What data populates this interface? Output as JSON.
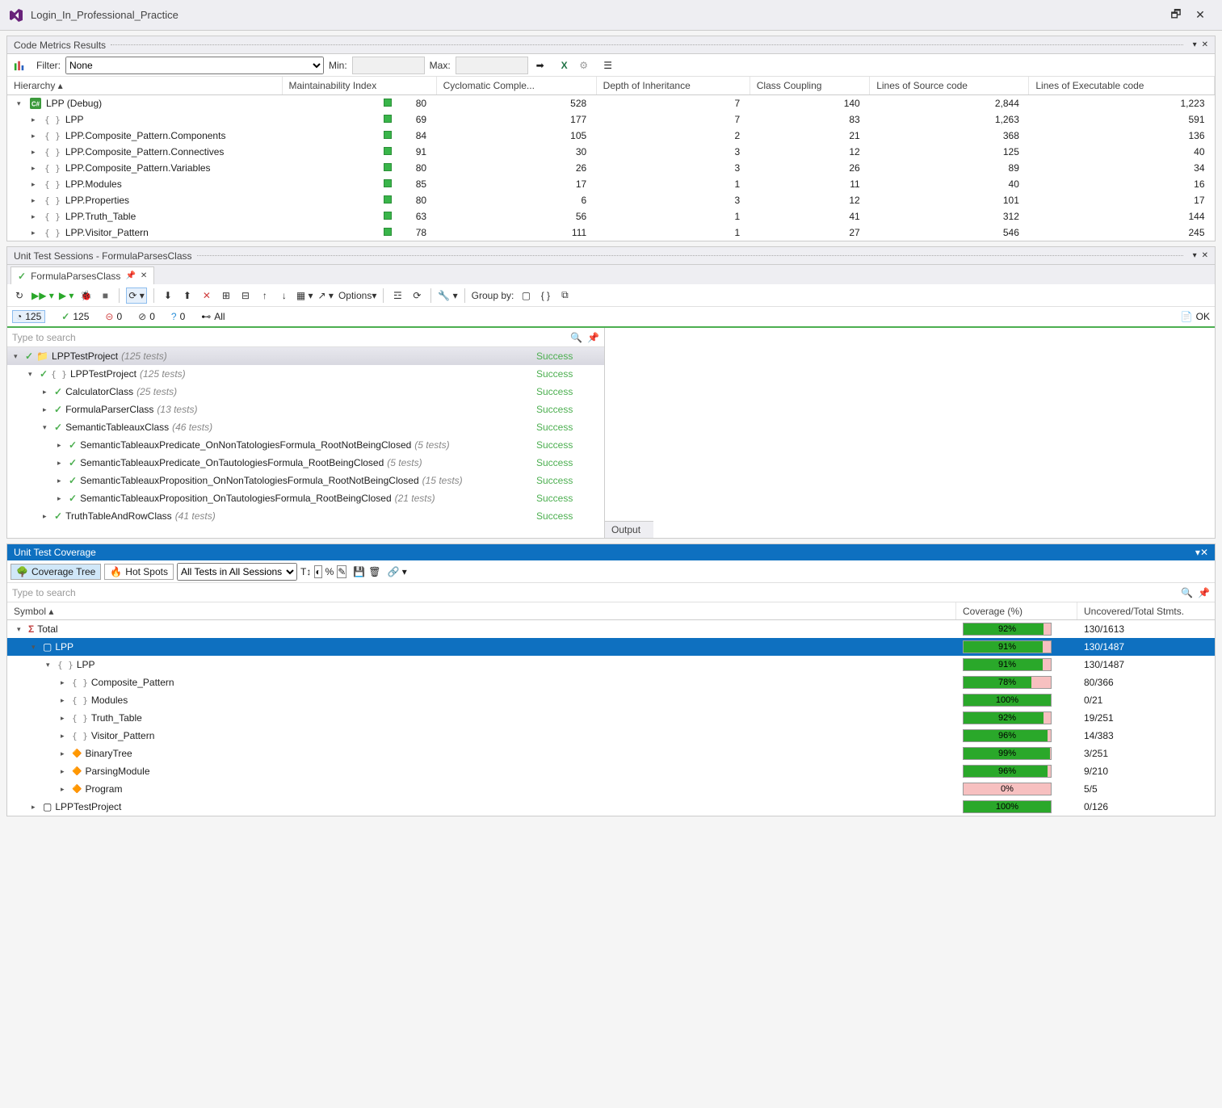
{
  "window": {
    "title": "Login_In_Professional_Practice"
  },
  "metrics": {
    "title": "Code Metrics Results",
    "filter_label": "Filter:",
    "filter_value": "None",
    "min_label": "Min:",
    "max_label": "Max:",
    "columns": [
      "Hierarchy",
      "Maintainability Index",
      "Cyclomatic Comple...",
      "Depth of Inheritance",
      "Class Coupling",
      "Lines of Source code",
      "Lines of Executable code"
    ],
    "rows": [
      {
        "indent": 0,
        "tri": "▾",
        "icon": "cs",
        "name": "LPP (Debug)",
        "vals": [
          "80",
          "528",
          "7",
          "140",
          "2,844",
          "1,223"
        ]
      },
      {
        "indent": 1,
        "tri": "▸",
        "icon": "ns",
        "name": "LPP",
        "vals": [
          "69",
          "177",
          "7",
          "83",
          "1,263",
          "591"
        ]
      },
      {
        "indent": 1,
        "tri": "▸",
        "icon": "ns",
        "name": "LPP.Composite_Pattern.Components",
        "vals": [
          "84",
          "105",
          "2",
          "21",
          "368",
          "136"
        ]
      },
      {
        "indent": 1,
        "tri": "▸",
        "icon": "ns",
        "name": "LPP.Composite_Pattern.Connectives",
        "vals": [
          "91",
          "30",
          "3",
          "12",
          "125",
          "40"
        ]
      },
      {
        "indent": 1,
        "tri": "▸",
        "icon": "ns",
        "name": "LPP.Composite_Pattern.Variables",
        "vals": [
          "80",
          "26",
          "3",
          "26",
          "89",
          "34"
        ]
      },
      {
        "indent": 1,
        "tri": "▸",
        "icon": "ns",
        "name": "LPP.Modules",
        "vals": [
          "85",
          "17",
          "1",
          "11",
          "40",
          "16"
        ]
      },
      {
        "indent": 1,
        "tri": "▸",
        "icon": "ns",
        "name": "LPP.Properties",
        "vals": [
          "80",
          "6",
          "3",
          "12",
          "101",
          "17"
        ]
      },
      {
        "indent": 1,
        "tri": "▸",
        "icon": "ns",
        "name": "LPP.Truth_Table",
        "vals": [
          "63",
          "56",
          "1",
          "41",
          "312",
          "144"
        ]
      },
      {
        "indent": 1,
        "tri": "▸",
        "icon": "ns",
        "name": "LPP.Visitor_Pattern",
        "vals": [
          "78",
          "111",
          "1",
          "27",
          "546",
          "245"
        ]
      }
    ]
  },
  "tests": {
    "title": "Unit Test Sessions - FormulaParsesClass",
    "tab": "FormulaParsesClass",
    "options_label": "Options",
    "groupby_label": "Group by:",
    "counts": {
      "total": "125",
      "passed": "125",
      "failed": "0",
      "ignored": "0",
      "unknown": "0",
      "all": "All"
    },
    "search_placeholder": "Type to search",
    "status_ok": "OK",
    "status_success": "Success",
    "output_label": "Output",
    "tree": [
      {
        "indent": 0,
        "tri": "▾",
        "icon": "proj",
        "name": "LPPTestProject",
        "count": "(125 tests)",
        "root": true
      },
      {
        "indent": 1,
        "tri": "▾",
        "icon": "ns",
        "name": "LPPTestProject",
        "count": "(125 tests)"
      },
      {
        "indent": 2,
        "tri": "▸",
        "icon": "chk",
        "name": "CalculatorClass",
        "count": "(25 tests)"
      },
      {
        "indent": 2,
        "tri": "▸",
        "icon": "chk",
        "name": "FormulaParserClass",
        "count": "(13 tests)"
      },
      {
        "indent": 2,
        "tri": "▾",
        "icon": "chk",
        "name": "SemanticTableauxClass",
        "count": "(46 tests)"
      },
      {
        "indent": 3,
        "tri": "▸",
        "icon": "chk",
        "name": "SemanticTableauxPredicate_OnNonTatologiesFormula_RootNotBeingClosed",
        "count": "(5 tests)"
      },
      {
        "indent": 3,
        "tri": "▸",
        "icon": "chk",
        "name": "SemanticTableauxPredicate_OnTautologiesFormula_RootBeingClosed",
        "count": "(5 tests)"
      },
      {
        "indent": 3,
        "tri": "▸",
        "icon": "chk",
        "name": "SemanticTableauxProposition_OnNonTatologiesFormula_RootNotBeingClosed",
        "count": "(15 tests)"
      },
      {
        "indent": 3,
        "tri": "▸",
        "icon": "chk",
        "name": "SemanticTableauxProposition_OnTautologiesFormula_RootBeingClosed",
        "count": "(21 tests)"
      },
      {
        "indent": 2,
        "tri": "▸",
        "icon": "chk",
        "name": "TruthTableAndRowClass",
        "count": "(41 tests)"
      }
    ]
  },
  "coverage": {
    "title": "Unit Test Coverage",
    "tabs": {
      "tree": "Coverage Tree",
      "hot": "Hot Spots"
    },
    "dropdown": "All Tests in All Sessions",
    "search_placeholder": "Type to search",
    "columns": [
      "Symbol",
      "Coverage (%)",
      "Uncovered/Total Stmts."
    ],
    "rows": [
      {
        "indent": 0,
        "tri": "▾",
        "icon": "sigma",
        "name": "Total",
        "pct": 92,
        "stmts": "130/1613",
        "sel": false
      },
      {
        "indent": 1,
        "tri": "▾",
        "icon": "box",
        "name": "LPP",
        "pct": 91,
        "stmts": "130/1487",
        "sel": true
      },
      {
        "indent": 2,
        "tri": "▾",
        "icon": "ns",
        "name": "LPP",
        "pct": 91,
        "stmts": "130/1487",
        "sel": false
      },
      {
        "indent": 3,
        "tri": "▸",
        "icon": "ns",
        "name": "Composite_Pattern",
        "pct": 78,
        "stmts": "80/366",
        "sel": false
      },
      {
        "indent": 3,
        "tri": "▸",
        "icon": "ns",
        "name": "Modules",
        "pct": 100,
        "stmts": "0/21",
        "sel": false
      },
      {
        "indent": 3,
        "tri": "▸",
        "icon": "ns",
        "name": "Truth_Table",
        "pct": 92,
        "stmts": "19/251",
        "sel": false
      },
      {
        "indent": 3,
        "tri": "▸",
        "icon": "ns",
        "name": "Visitor_Pattern",
        "pct": 96,
        "stmts": "14/383",
        "sel": false
      },
      {
        "indent": 3,
        "tri": "▸",
        "icon": "cls",
        "name": "BinaryTree",
        "pct": 99,
        "stmts": "3/251",
        "sel": false
      },
      {
        "indent": 3,
        "tri": "▸",
        "icon": "cls",
        "name": "ParsingModule",
        "pct": 96,
        "stmts": "9/210",
        "sel": false
      },
      {
        "indent": 3,
        "tri": "▸",
        "icon": "cls",
        "name": "Program",
        "pct": 0,
        "stmts": "5/5",
        "sel": false
      },
      {
        "indent": 1,
        "tri": "▸",
        "icon": "box",
        "name": "LPPTestProject",
        "pct": 100,
        "stmts": "0/126",
        "sel": false
      }
    ]
  }
}
